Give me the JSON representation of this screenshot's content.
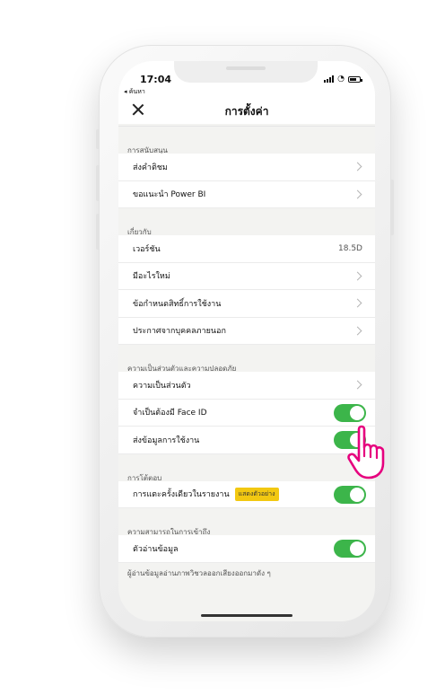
{
  "status": {
    "time": "17:04",
    "back_label": "◂ ค้นหา"
  },
  "nav": {
    "title": "การตั้งค่า"
  },
  "sections": {
    "support": {
      "header": "การสนับสนุน",
      "rows": [
        "ส่งคำติชม",
        "ขอแนะนำ Power BI"
      ]
    },
    "about": {
      "header": "เกี่ยวกับ",
      "version_label": "เวอร์ชัน",
      "version_value": "18.5D",
      "rows": [
        "มีอะไรใหม่",
        "ข้อกำหนดสิทธิ์การใช้งาน",
        "ประกาศจากบุคคลภายนอก"
      ]
    },
    "privacy": {
      "header": "ความเป็นส่วนตัวและความปลอดภัย",
      "privacy_label": "ความเป็นส่วนตัว",
      "face_id_label": "จำเป็นต้องมี Face ID",
      "face_id_on": true,
      "usage_label": "ส่งข้อมูลการใช้งาน",
      "usage_on": true
    },
    "interaction": {
      "header": "การโต้ตอบ",
      "single_tap_label": "การแตะครั้งเดียวในรายงาน",
      "single_tap_badge": "แสดงตัวอย่าง",
      "single_tap_on": true
    },
    "accessibility": {
      "header": "ความสามารถในการเข้าถึง",
      "reader_label": "ตัวอ่านข้อมูล",
      "reader_on": true,
      "footnote": "ผู้อ่านข้อมูลอ่านภาพวิชวลออกเสียงออกมาดัง ๆ"
    }
  },
  "colors": {
    "toggle_on": "#3cb54a",
    "badge": "#f2c811",
    "hand_icon": "#e6007e"
  }
}
